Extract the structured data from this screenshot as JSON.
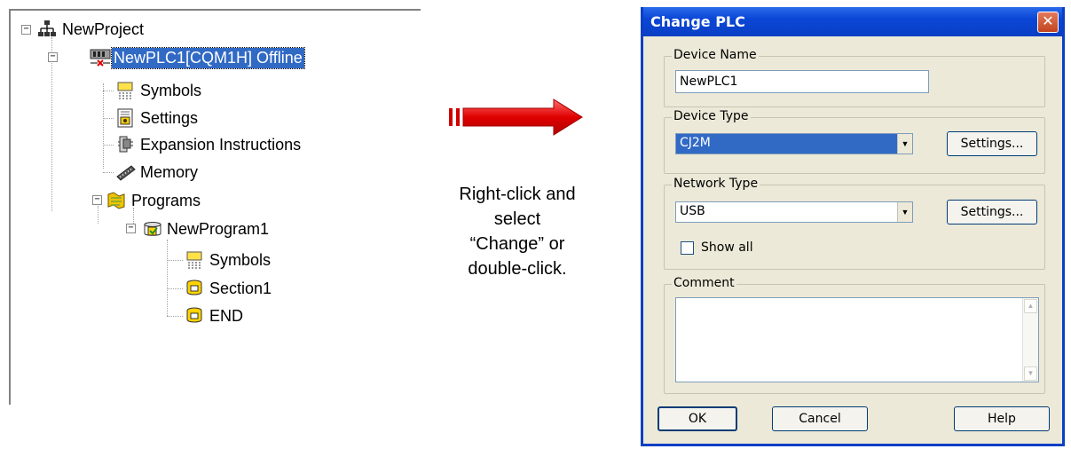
{
  "tree": {
    "root": "NewProject",
    "plc": "NewPLC1[CQM1H] Offline",
    "plc_children": [
      "Symbols",
      "Settings",
      "Expansion Instructions",
      "Memory",
      "Programs"
    ],
    "program": "NewProgram1",
    "program_children": [
      "Symbols",
      "Section1",
      "END"
    ]
  },
  "callout": {
    "line1": "Right-click and",
    "line2": "select",
    "line3": "“Change” or",
    "line4": "double-click."
  },
  "dialog": {
    "title": "Change PLC",
    "device_name": {
      "label": "Device Name",
      "value": "NewPLC1"
    },
    "device_type": {
      "label": "Device Type",
      "value": "CJ2M",
      "settings_label": "Settings..."
    },
    "network_type": {
      "label": "Network Type",
      "value": "USB",
      "settings_label": "Settings...",
      "show_all_label": "Show all"
    },
    "comment": {
      "label": "Comment",
      "value": ""
    },
    "buttons": {
      "ok": "OK",
      "cancel": "Cancel",
      "help": "Help"
    }
  },
  "colors": {
    "selection": "#316ac5",
    "titlebar": "#0a46d6",
    "arrow": "#e00000",
    "dialog_bg": "#ece9d8"
  }
}
